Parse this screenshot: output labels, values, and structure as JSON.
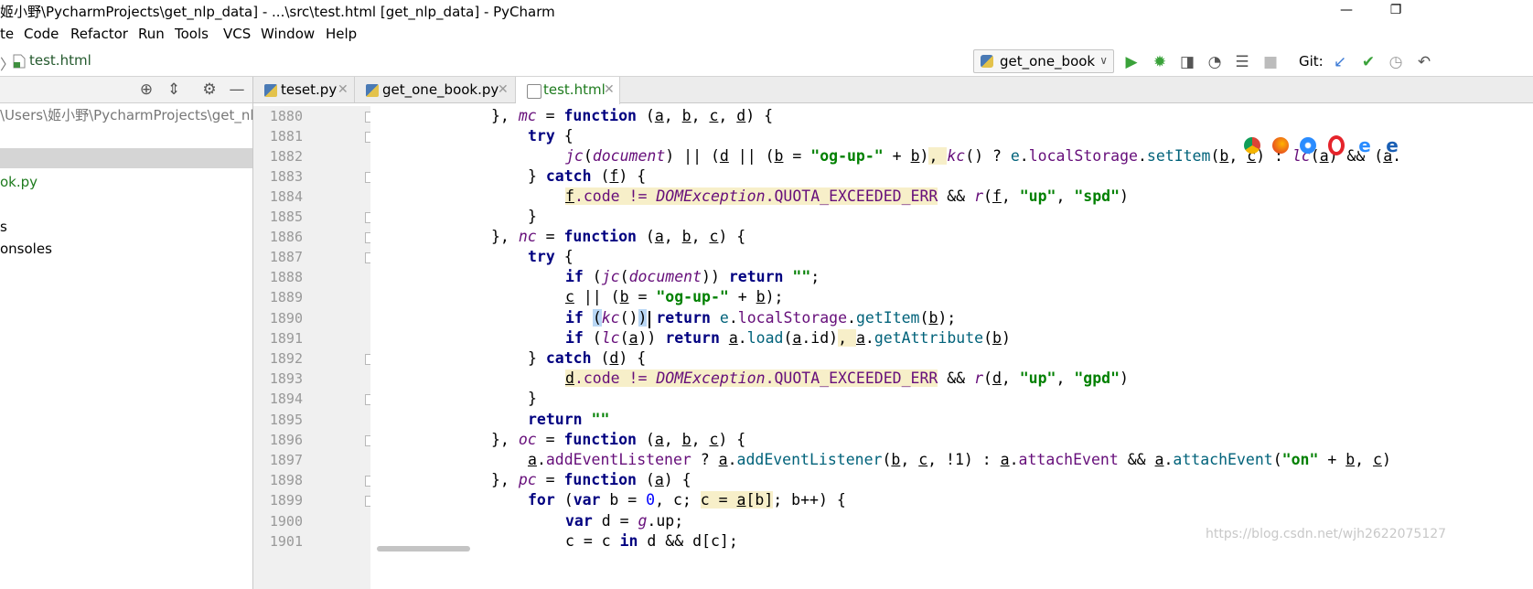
{
  "window": {
    "title": "姬小野\\PycharmProjects\\get_nlp_data] - ...\\src\\test.html [get_nlp_data] - PyCharm",
    "minimize_glyph": "—",
    "restore_glyph": "❐"
  },
  "menu": [
    "te",
    "Code",
    "Refactor",
    "Run",
    "Tools",
    "VCS",
    "Window",
    "Help"
  ],
  "breadcrumb": {
    "file": "test.html"
  },
  "run_config": {
    "label": "get_one_book"
  },
  "toolbar": {
    "git_label": "Git:"
  },
  "project_panel": {
    "path": "\\Users\\姬小野\\PycharmProjects\\get_nlp_d",
    "rows": [
      "ok.py",
      "s",
      "onsoles"
    ]
  },
  "tabs": [
    {
      "label": "teset.py",
      "active": false
    },
    {
      "label": "get_one_book.py",
      "active": false
    },
    {
      "label": "test.html",
      "active": true
    }
  ],
  "line_numbers": [
    "1880",
    "1881",
    "1882",
    "1883",
    "1884",
    "1885",
    "1886",
    "1887",
    "1888",
    "1889",
    "1890",
    "1891",
    "1892",
    "1893",
    "1894",
    "1895",
    "1896",
    "1897",
    "1898",
    "1899",
    "1900",
    "1901"
  ],
  "code": {
    "l1880": [
      "}, ",
      "mc",
      " = ",
      "function",
      " (",
      "a",
      ", ",
      "b",
      ", ",
      "c",
      ", ",
      "d",
      ") {"
    ],
    "l1881": [
      "try",
      " {"
    ],
    "l1882": [
      "jc",
      "(",
      "document",
      ") || (",
      "d",
      " || (",
      "b",
      " = ",
      "\"og-up-\"",
      " + ",
      "b",
      ")",
      ", ",
      "kc",
      "() ? ",
      "e",
      ".",
      "localStorage",
      ".",
      "setItem",
      "(",
      "b",
      ", ",
      "c",
      ") : ",
      "lc",
      "(",
      "a",
      ") && (",
      "a",
      "."
    ],
    "l1883": [
      "} ",
      "catch",
      " (",
      "f",
      ") {"
    ],
    "l1884": [
      "f",
      ".code != ",
      "DOMException",
      ".QUOTA_EXCEEDED_ERR",
      " && ",
      "r",
      "(",
      "f",
      ", ",
      "\"up\"",
      ", ",
      "\"spd\"",
      ")"
    ],
    "l1885": [
      "}"
    ],
    "l1886": [
      "}, ",
      "nc",
      " = ",
      "function",
      " (",
      "a",
      ", ",
      "b",
      ", ",
      "c",
      ") {"
    ],
    "l1887": [
      "try",
      " {"
    ],
    "l1888": [
      "if",
      " (",
      "jc",
      "(",
      "document",
      ")) ",
      "return",
      " ",
      "\"\"",
      ";"
    ],
    "l1889": [
      "c",
      " || (",
      "b",
      " = ",
      "\"og-up-\"",
      " + ",
      "b",
      ");"
    ],
    "l1890": [
      "if",
      " ",
      "(",
      "kc",
      "()",
      ")",
      " ",
      "return",
      " ",
      "e",
      ".",
      "localStorage",
      ".",
      "getItem",
      "(",
      "b",
      ");"
    ],
    "l1891": [
      "if",
      " (",
      "lc",
      "(",
      "a",
      ")) ",
      "return",
      " ",
      "a",
      ".",
      "load",
      "(",
      "a",
      ".id)",
      ", ",
      "a",
      ".",
      "getAttribute",
      "(",
      "b",
      ")"
    ],
    "l1892": [
      "} ",
      "catch",
      " (",
      "d",
      ") {"
    ],
    "l1893": [
      "d",
      ".code != ",
      "DOMException",
      ".QUOTA_EXCEEDED_ERR",
      " && ",
      "r",
      "(",
      "d",
      ", ",
      "\"up\"",
      ", ",
      "\"gpd\"",
      ")"
    ],
    "l1894": [
      "}"
    ],
    "l1895": [
      "return",
      " ",
      "\"\""
    ],
    "l1896": [
      "}, ",
      "oc",
      " = ",
      "function",
      " (",
      "a",
      ", ",
      "b",
      ", ",
      "c",
      ") {"
    ],
    "l1897": [
      "a",
      ".",
      "addEventListener",
      " ? ",
      "a",
      ".",
      "addEventListener",
      "(",
      "b",
      ", ",
      "c",
      ", !1) : ",
      "a",
      ".",
      "attachEvent",
      " && ",
      "a",
      ".",
      "attachEvent",
      "(",
      "\"on\"",
      " + ",
      "b",
      ", ",
      "c",
      ")"
    ],
    "l1898": [
      "}, ",
      "pc",
      " = ",
      "function",
      " (",
      "a",
      ") {"
    ],
    "l1899": [
      "for",
      " (",
      "var",
      " b = ",
      "0",
      ", c; ",
      "c = ",
      "a",
      "[b]",
      "; b++) {"
    ],
    "l1900": [
      "var",
      " d = ",
      "g",
      ".up;"
    ],
    "l1901": [
      "c = c ",
      "in",
      " d && d[c];"
    ]
  },
  "watermark": "https://blog.csdn.net/wjh2622075127"
}
